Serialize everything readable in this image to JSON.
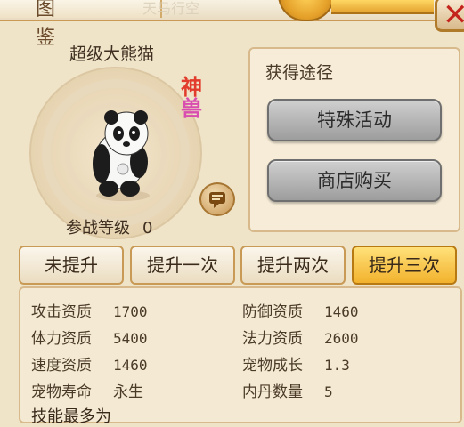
{
  "header": {
    "title": "图 鉴",
    "decor_text": "天马行空"
  },
  "pet": {
    "name": "超级大熊猫",
    "rank_top": "神",
    "rank_bottom": "兽",
    "level_label": "参战等级",
    "level_value": "0"
  },
  "source": {
    "title": "获得途径",
    "buttons": [
      "特殊活动",
      "商店购买"
    ]
  },
  "tabs": [
    {
      "label": "未提升",
      "active": false
    },
    {
      "label": "提升一次",
      "active": false
    },
    {
      "label": "提升两次",
      "active": false
    },
    {
      "label": "提升三次",
      "active": true
    }
  ],
  "stats": {
    "left": [
      {
        "label": "攻击资质",
        "value": "1700"
      },
      {
        "label": "体力资质",
        "value": "5400"
      },
      {
        "label": "速度资质",
        "value": "1460"
      },
      {
        "label": "宠物寿命",
        "value": "永生"
      }
    ],
    "right": [
      {
        "label": "防御资质",
        "value": "1460"
      },
      {
        "label": "法力资质",
        "value": "2600"
      },
      {
        "label": "宠物成长",
        "value": "1.3"
      },
      {
        "label": "内丹数量",
        "value": "5"
      }
    ],
    "skills_label": "技能最多为"
  },
  "icons": {
    "close": "close-icon",
    "chat": "chat-bubble-icon"
  },
  "colors": {
    "accent": "#f2b22d",
    "close": "#c4241b"
  }
}
